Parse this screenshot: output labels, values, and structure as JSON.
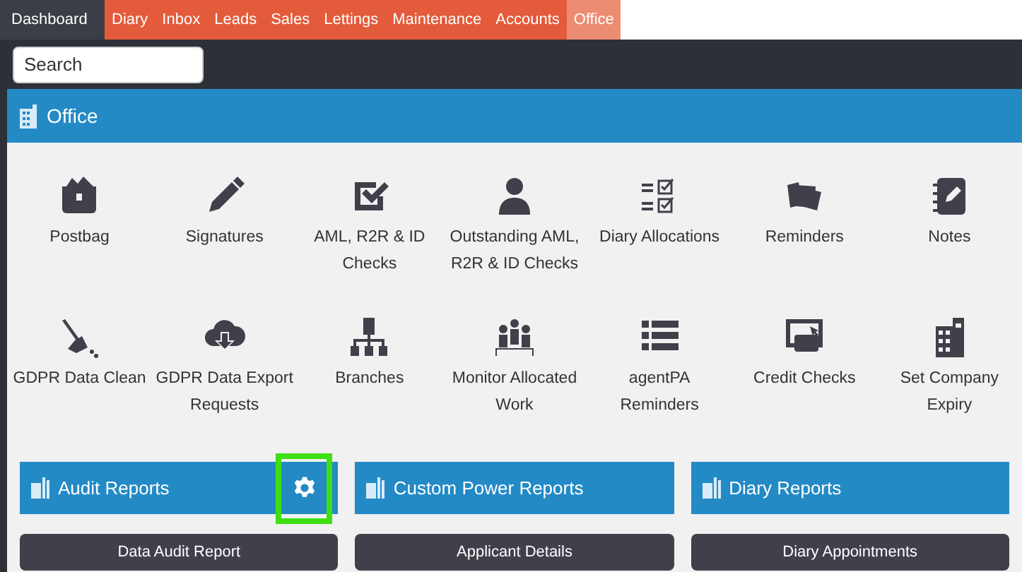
{
  "nav": [
    {
      "label": "Dashboard",
      "kind": "home",
      "selected": false
    },
    {
      "label": "Diary",
      "kind": "module",
      "selected": false
    },
    {
      "label": "Inbox",
      "kind": "module",
      "selected": false
    },
    {
      "label": "Leads",
      "kind": "module",
      "selected": false
    },
    {
      "label": "Sales",
      "kind": "module",
      "selected": false
    },
    {
      "label": "Lettings",
      "kind": "module",
      "selected": false
    },
    {
      "label": "Maintenance",
      "kind": "module",
      "selected": false
    },
    {
      "label": "Accounts",
      "kind": "module",
      "selected": false
    },
    {
      "label": "Office",
      "kind": "module",
      "selected": true
    }
  ],
  "search": {
    "placeholder": "Search"
  },
  "panel": {
    "title": "Office"
  },
  "tiles": [
    {
      "label": "Postbag"
    },
    {
      "label": "Signatures"
    },
    {
      "label": "AML, R2R & ID Checks"
    },
    {
      "label": "Outstanding AML, R2R & ID Checks"
    },
    {
      "label": "Diary Allocations"
    },
    {
      "label": "Reminders"
    },
    {
      "label": "Notes"
    },
    {
      "label": "GDPR Data Clean"
    },
    {
      "label": "GDPR Data Export Requests"
    },
    {
      "label": "Branches"
    },
    {
      "label": "Monitor Allocated Work"
    },
    {
      "label": "agentPA Reminders"
    },
    {
      "label": "Credit Checks"
    },
    {
      "label": "Set Company Expiry"
    }
  ],
  "sections": [
    {
      "title": "Audit Reports",
      "settings": true,
      "highlighted": true,
      "buttons": [
        "Data Audit Report"
      ]
    },
    {
      "title": "Custom Power Reports",
      "settings": false,
      "highlighted": false,
      "buttons": [
        "Applicant Details"
      ]
    },
    {
      "title": "Diary Reports",
      "settings": false,
      "highlighted": false,
      "buttons": [
        "Diary Appointments"
      ]
    }
  ]
}
